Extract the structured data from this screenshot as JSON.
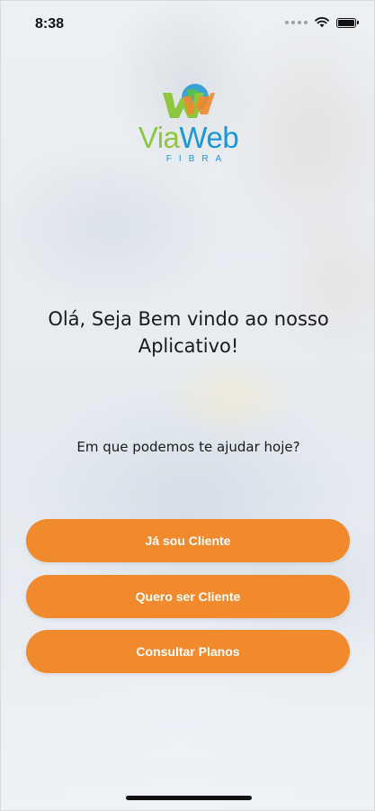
{
  "status_bar": {
    "time": "8:38",
    "icons": [
      "signal-dots-icon",
      "wifi-icon",
      "battery-icon"
    ]
  },
  "logo": {
    "word_part1": "Via",
    "word_part2": "Web",
    "subtitle": "FIBRA",
    "colors": {
      "green": "#8dc63f",
      "blue": "#1c96d4",
      "orange": "#f08a2c"
    }
  },
  "main": {
    "welcome_text": "Olá, Seja Bem vindo ao nosso Aplicativo!",
    "help_text": "Em que podemos te ajudar hoje?"
  },
  "buttons": {
    "existing_client": "Já sou Cliente",
    "become_client": "Quero ser Cliente",
    "view_plans": "Consultar Planos"
  },
  "theme": {
    "button_color": "#f08a2c",
    "button_text_color": "#ffffff",
    "text_color": "#1a1a1a"
  }
}
